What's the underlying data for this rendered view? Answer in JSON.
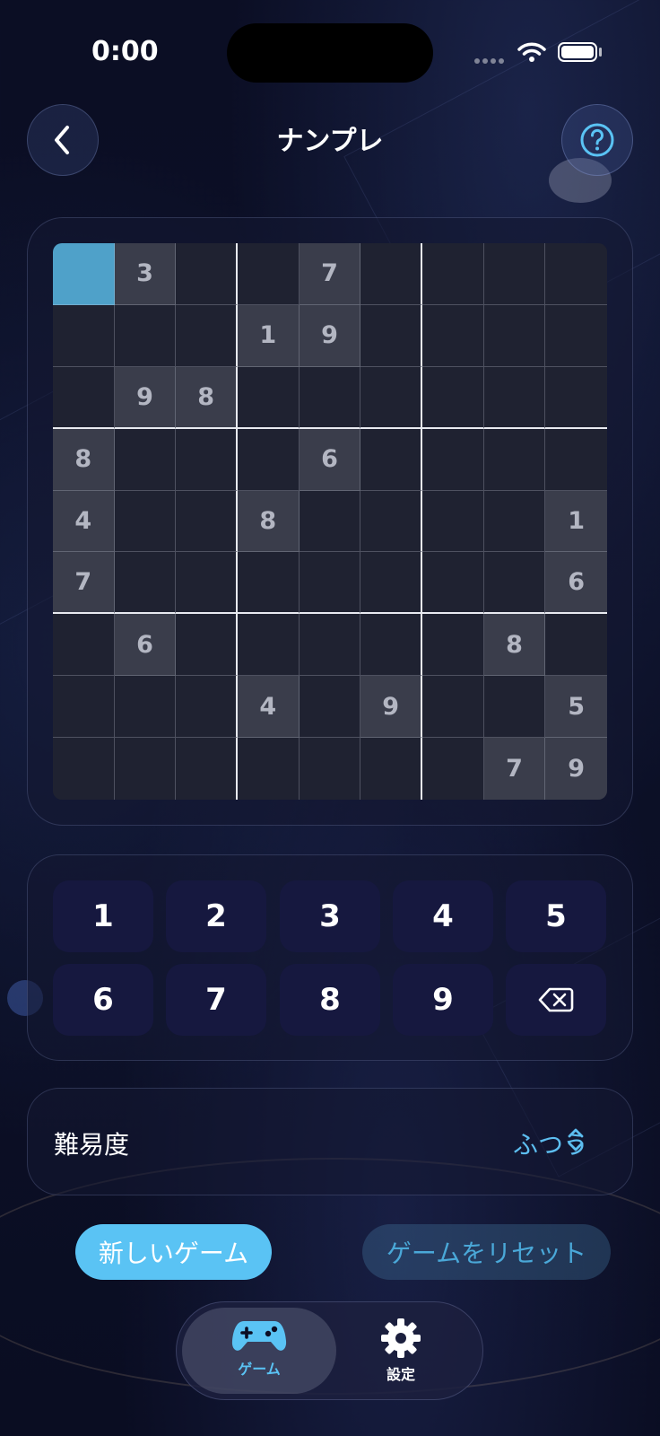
{
  "status_bar": {
    "time": "0:00"
  },
  "header": {
    "title": "ナンプレ",
    "back_icon": "chevron-left-icon",
    "help_icon": "question-circle-icon"
  },
  "board": {
    "selected": [
      0,
      0
    ],
    "rows": [
      [
        "",
        "3",
        "",
        "",
        "7",
        "",
        "",
        "",
        ""
      ],
      [
        "",
        "",
        "",
        "1",
        "9",
        "",
        "",
        "",
        ""
      ],
      [
        "",
        "9",
        "8",
        "",
        "",
        "",
        "",
        "",
        ""
      ],
      [
        "8",
        "",
        "",
        "",
        "6",
        "",
        "",
        "",
        ""
      ],
      [
        "4",
        "",
        "",
        "8",
        "",
        "",
        "",
        "",
        "1"
      ],
      [
        "7",
        "",
        "",
        "",
        "",
        "",
        "",
        "",
        "6"
      ],
      [
        "",
        "6",
        "",
        "",
        "",
        "",
        "",
        "8",
        ""
      ],
      [
        "",
        "",
        "",
        "4",
        "",
        "9",
        "",
        "",
        "5"
      ],
      [
        "",
        "",
        "",
        "",
        "",
        "",
        "",
        "7",
        "9"
      ]
    ]
  },
  "keypad": {
    "keys": [
      "1",
      "2",
      "3",
      "4",
      "5",
      "6",
      "7",
      "8",
      "9"
    ],
    "delete_icon": "backspace-icon"
  },
  "difficulty": {
    "label": "難易度",
    "value": "ふつう"
  },
  "actions": {
    "new_game": "新しいゲーム",
    "reset": "ゲームをリセット"
  },
  "tabs": [
    {
      "label": "ゲーム",
      "icon": "gamepad-icon",
      "active": true
    },
    {
      "label": "設定",
      "icon": "gear-icon",
      "active": false
    }
  ],
  "colors": {
    "accent": "#5ac3f4",
    "selected_cell": "#4fa1c9",
    "given_cell": "#3a3d4b"
  }
}
